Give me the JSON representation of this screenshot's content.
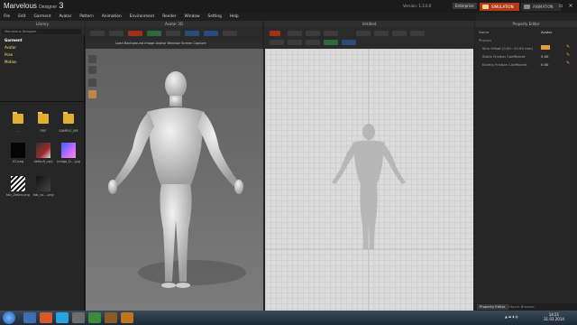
{
  "app": {
    "logo_main": "Marvelous",
    "logo_sub": "Designer",
    "logo_ver": "3",
    "version": "Version: 1.3.0.0",
    "edition": "Enterprise"
  },
  "mode_tabs": {
    "simulation": "SIMULATION",
    "animation": "ANIMATION"
  },
  "menubar": [
    "File",
    "Edit",
    "Garment",
    "Avatar",
    "Pattern",
    "Animation",
    "Environment",
    "Render",
    "Window",
    "Setting",
    "Help"
  ],
  "library": {
    "title": "Library",
    "path": "Marvelous Designer",
    "tree": [
      {
        "label": "Garment",
        "selected": true
      },
      {
        "label": "Avatar",
        "selected": false
      },
      {
        "label": "Pose",
        "selected": false
      },
      {
        "label": "Motion",
        "selected": false
      }
    ],
    "items": [
      {
        "label": "..",
        "kind": "folder"
      },
      {
        "label": "PDF",
        "kind": "folder"
      },
      {
        "label": "SAMPLE_ME",
        "kind": "folder"
      },
      {
        "label": "01.png",
        "kind": "black"
      },
      {
        "label": "default_zprj",
        "kind": "fabric"
      },
      {
        "label": "Indigo_D....jpg",
        "kind": "gradient"
      },
      {
        "label": "fab_Zebra.png",
        "kind": "zebra"
      },
      {
        "label": "fab_co....png",
        "kind": "dark"
      }
    ]
  },
  "view3d": {
    "title": "Avatar 3D",
    "menu": "Load Background Image  Avatar  Window  Screen Capture"
  },
  "view2d": {
    "title": "Untitled"
  },
  "props": {
    "title": "Property Editor",
    "col_name": "Name",
    "col_value": "Avatar",
    "section": "Physics",
    "rows": [
      {
        "label": "Skin Offset (0.00~10.00 mm)",
        "value": ""
      },
      {
        "label": "Static Friction Coefficient",
        "value": "5.00"
      },
      {
        "label": "Kinetic Friction Coefficient",
        "value": "0.00"
      }
    ],
    "tab_active": "Property Editor",
    "tab_inactive": "Object Browser"
  },
  "taskbar": {
    "time": "14:21",
    "date": "31.03.2014"
  },
  "colors": {
    "accent": "#b33a14",
    "folder": "#e3ae34",
    "tree_text": "#f1e16e"
  }
}
